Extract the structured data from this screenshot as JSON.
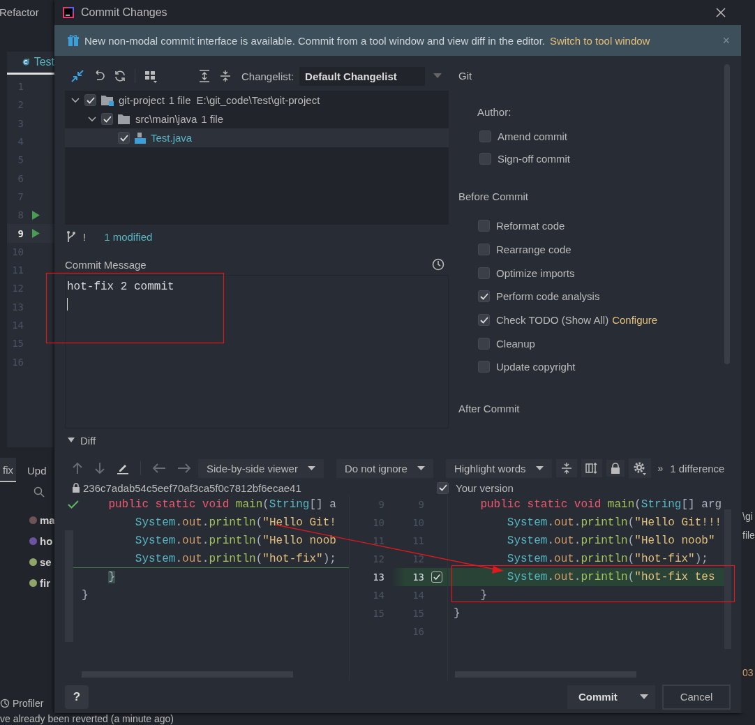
{
  "ide": {
    "menu_item": "Refactor",
    "editor_tab": "Test",
    "line_numbers": [
      {
        "number": "1",
        "run": false,
        "current": false
      },
      {
        "number": "2",
        "run": false,
        "current": false
      },
      {
        "number": "3",
        "run": false,
        "current": false
      },
      {
        "number": "4",
        "run": false,
        "current": false
      },
      {
        "number": "5",
        "run": false,
        "current": false
      },
      {
        "number": "6",
        "run": false,
        "current": false
      },
      {
        "number": "7",
        "run": false,
        "current": false
      },
      {
        "number": "8",
        "run": true,
        "current": false
      },
      {
        "number": "9",
        "run": true,
        "current": true
      },
      {
        "number": "10",
        "run": false,
        "current": false
      },
      {
        "number": "11",
        "run": false,
        "current": false
      },
      {
        "number": "12",
        "run": false,
        "current": false
      },
      {
        "number": "13",
        "run": false,
        "current": false
      },
      {
        "number": "14",
        "run": false,
        "current": false
      },
      {
        "number": "15",
        "run": false,
        "current": false
      },
      {
        "number": "16",
        "run": false,
        "current": false
      }
    ],
    "tool_tabs": [
      {
        "label": "fix",
        "selected": true
      },
      {
        "label": "Upd",
        "selected": false
      }
    ],
    "git_log": [
      {
        "label": "ma",
        "color": "#6e5456"
      },
      {
        "label": "ho",
        "color": "#6a54a0"
      },
      {
        "label": "se",
        "color": "#8fa56a"
      },
      {
        "label": "fir",
        "color": "#8fa56a"
      }
    ],
    "profiler": "Profiler",
    "status_text": "ve already been reverted (a minute ago)",
    "right_fragments": [
      "\\gi",
      "file",
      "03"
    ]
  },
  "dialog": {
    "title": "Commit Changes",
    "banner": {
      "text": "New non-modal commit interface is available. Commit from a tool window and view diff in the editor.",
      "link": "Switch to tool window",
      "close": "×"
    },
    "changelist_label": "Changelist:",
    "changelist": "Default Changelist",
    "tree": [
      {
        "label": "git-project",
        "count": "1 file",
        "path": "E:\\git_code\\Test\\git-project",
        "kind": "module",
        "checked": true,
        "expanded": true,
        "selected": false,
        "children": [
          {
            "label": "src\\main\\java",
            "count": "1 file",
            "kind": "folder",
            "checked": true,
            "expanded": true,
            "selected": false,
            "children": [
              {
                "label": "Test.java",
                "kind": "file",
                "checked": true,
                "selected": true
              }
            ]
          }
        ]
      }
    ],
    "status_mark": "!",
    "status": "1 modified",
    "commit_message": {
      "label": "Commit Message",
      "value": "hot-fix 2 commit"
    },
    "vcs": "Git",
    "author_label": "Author:",
    "author_options": [
      {
        "label": "Amend commit",
        "checked": false
      },
      {
        "label": "Sign-off commit",
        "checked": false
      }
    ],
    "before_commit_label": "Before Commit",
    "before_commit": [
      {
        "label": "Reformat code",
        "checked": false
      },
      {
        "label": "Rearrange code",
        "checked": false
      },
      {
        "label": "Optimize imports",
        "checked": false
      },
      {
        "label": "Perform code analysis",
        "checked": true
      },
      {
        "label": "Check TODO (Show All)",
        "checked": true,
        "link": "Configure"
      },
      {
        "label": "Cleanup",
        "checked": false
      },
      {
        "label": "Update copyright",
        "checked": false
      }
    ],
    "after_commit_label": "After Commit",
    "diff": {
      "title": "Diff",
      "expanded": true,
      "viewer": "Side-by-side viewer",
      "ignore": "Do not ignore",
      "highlight": "Highlight words",
      "more": "»",
      "count": "1 difference",
      "left_header": "236c7adab54c5eef70af3ca5f0c7812bf6ecae41",
      "right_header": "Your version",
      "right_checked": true,
      "rows": [
        {
          "left_number": "9",
          "right_number": "9",
          "changed": false,
          "left_code": [
            {
              "text": "    public static void ",
              "kind": "keyword"
            },
            {
              "text": "main",
              "kind": "function"
            },
            {
              "text": "(",
              "kind": "plain"
            },
            {
              "text": "String",
              "kind": "type"
            },
            {
              "text": "[] a",
              "kind": "plain"
            }
          ],
          "right_code": [
            {
              "text": "    public static void ",
              "kind": "keyword"
            },
            {
              "text": "main",
              "kind": "function"
            },
            {
              "text": "(",
              "kind": "plain"
            },
            {
              "text": "String",
              "kind": "type"
            },
            {
              "text": "[] arg",
              "kind": "plain"
            }
          ]
        },
        {
          "left_number": "10",
          "right_number": "10",
          "changed": false,
          "left_code": [
            {
              "text": "        System",
              "kind": "type"
            },
            {
              "text": ".",
              "kind": "plain"
            },
            {
              "text": "out",
              "kind": "field"
            },
            {
              "text": ".",
              "kind": "plain"
            },
            {
              "text": "println",
              "kind": "function"
            },
            {
              "text": "(",
              "kind": "plain"
            },
            {
              "text": "\"Hello Git!",
              "kind": "string"
            }
          ],
          "right_code": [
            {
              "text": "        System",
              "kind": "type"
            },
            {
              "text": ".",
              "kind": "plain"
            },
            {
              "text": "out",
              "kind": "field"
            },
            {
              "text": ".",
              "kind": "plain"
            },
            {
              "text": "println",
              "kind": "function"
            },
            {
              "text": "(",
              "kind": "plain"
            },
            {
              "text": "\"Hello Git!!!",
              "kind": "string"
            }
          ]
        },
        {
          "left_number": "11",
          "right_number": "11",
          "changed": false,
          "left_code": [
            {
              "text": "        System",
              "kind": "type"
            },
            {
              "text": ".",
              "kind": "plain"
            },
            {
              "text": "out",
              "kind": "field"
            },
            {
              "text": ".",
              "kind": "plain"
            },
            {
              "text": "println",
              "kind": "function"
            },
            {
              "text": "(",
              "kind": "plain"
            },
            {
              "text": "\"Hello noob",
              "kind": "string"
            }
          ],
          "right_code": [
            {
              "text": "        System",
              "kind": "type"
            },
            {
              "text": ".",
              "kind": "plain"
            },
            {
              "text": "out",
              "kind": "field"
            },
            {
              "text": ".",
              "kind": "plain"
            },
            {
              "text": "println",
              "kind": "function"
            },
            {
              "text": "(",
              "kind": "plain"
            },
            {
              "text": "\"Hello noob\"",
              "kind": "string"
            }
          ]
        },
        {
          "left_number": "12",
          "right_number": "12",
          "changed": false,
          "left_code": [
            {
              "text": "        System",
              "kind": "type"
            },
            {
              "text": ".",
              "kind": "plain"
            },
            {
              "text": "out",
              "kind": "field"
            },
            {
              "text": ".",
              "kind": "plain"
            },
            {
              "text": "println",
              "kind": "function"
            },
            {
              "text": "(",
              "kind": "plain"
            },
            {
              "text": "\"hot-fix\"",
              "kind": "string"
            },
            {
              "text": ");",
              "kind": "plain"
            }
          ],
          "right_code": [
            {
              "text": "        System",
              "kind": "type"
            },
            {
              "text": ".",
              "kind": "plain"
            },
            {
              "text": "out",
              "kind": "field"
            },
            {
              "text": ".",
              "kind": "plain"
            },
            {
              "text": "println",
              "kind": "function"
            },
            {
              "text": "(",
              "kind": "plain"
            },
            {
              "text": "\"hot-fix\"",
              "kind": "string"
            },
            {
              "text": ");",
              "kind": "plain"
            }
          ]
        },
        {
          "left_number": "13",
          "right_number": "13",
          "changed": true,
          "included": true,
          "left_code": [
            {
              "text": "    }",
              "kind": "brace"
            }
          ],
          "right_code": [
            {
              "text": "        System",
              "kind": "type"
            },
            {
              "text": ".",
              "kind": "plain"
            },
            {
              "text": "out",
              "kind": "field"
            },
            {
              "text": ".",
              "kind": "plain"
            },
            {
              "text": "println",
              "kind": "function"
            },
            {
              "text": "(",
              "kind": "plain"
            },
            {
              "text": "\"hot-fix tes",
              "kind": "string"
            }
          ]
        },
        {
          "left_number": "14",
          "right_number": "14",
          "changed": false,
          "left_code": [
            {
              "text": "}",
              "kind": "plain"
            }
          ],
          "right_code": [
            {
              "text": "    }",
              "kind": "plain"
            }
          ]
        },
        {
          "left_number": "15",
          "right_number": "15",
          "changed": false,
          "left_code": [],
          "right_code": [
            {
              "text": "}",
              "kind": "plain"
            }
          ]
        },
        {
          "right_number": "16",
          "changed": false,
          "left_code": [],
          "right_code": []
        }
      ]
    },
    "help": "?",
    "commit_button": "Commit",
    "cancel_button": "Cancel"
  }
}
